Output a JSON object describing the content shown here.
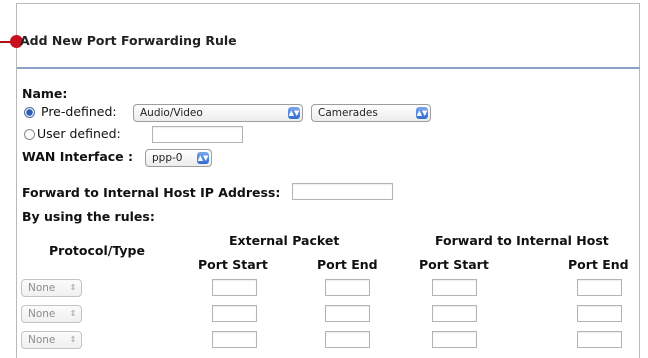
{
  "page": {
    "title": "Add New Port Forwarding Rule"
  },
  "form": {
    "name_label": "Name:",
    "predefined_label": "Pre-defined:",
    "predefined_category": "Audio/Video",
    "predefined_service": "Camerades",
    "predefined_selected": true,
    "user_defined_label": "User defined:",
    "user_defined_value": "",
    "wan_interface_label": "WAN Interface :",
    "wan_interface_value": "ppp-0",
    "forward_ip_label": "Forward to Internal Host IP Address:",
    "forward_ip_value": "",
    "rules_label": "By using the rules:"
  },
  "rules_table": {
    "protocol_header": "Protocol/Type",
    "external_header": "External Packet",
    "internal_header": "Forward to Internal Host",
    "port_start_header": "Port Start",
    "port_end_header": "Port End",
    "rows": [
      {
        "protocol": "None",
        "ext_start": "",
        "ext_end": "",
        "int_start": "",
        "int_end": ""
      },
      {
        "protocol": "None",
        "ext_start": "",
        "ext_end": "",
        "int_start": "",
        "int_end": ""
      },
      {
        "protocol": "None",
        "ext_start": "",
        "ext_end": "",
        "int_start": "",
        "int_end": ""
      }
    ]
  },
  "colors": {
    "annotation": "#c80f1e",
    "title_rule": "#8aa2c4",
    "select_arrow": "#2f6cd0"
  }
}
